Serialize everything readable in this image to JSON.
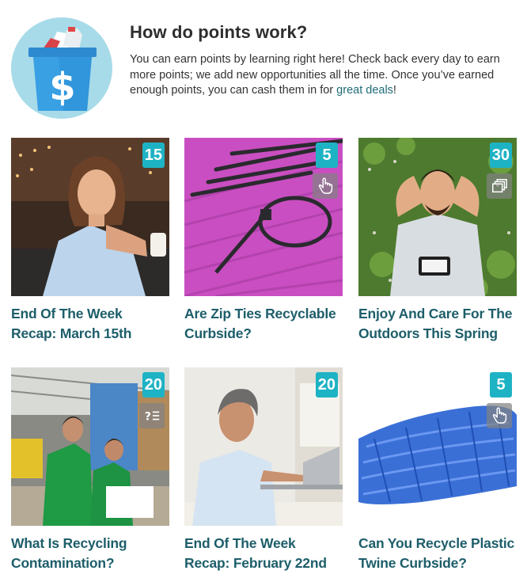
{
  "header": {
    "title": "How do points work?",
    "text_before_link": "You can earn points by learning right here! Check back every day to earn more points; we add new opportunities all the time. Once you’ve earned enough points, you can cash them in for ",
    "link_text": "great deals",
    "text_after_link": "!"
  },
  "cards": [
    {
      "points": "15",
      "type_icon": "none",
      "title": "End Of The Week Recap: March 15th"
    },
    {
      "points": "5",
      "type_icon": "hand-pointer-icon",
      "title": "Are Zip Ties Recyclable Curbside?"
    },
    {
      "points": "30",
      "type_icon": "gallery-icon",
      "title": "Enjoy And Care For The Outdoors This Spring"
    },
    {
      "points": "20",
      "type_icon": "quiz-icon",
      "title": "What Is Recycling Contamination?"
    },
    {
      "points": "20",
      "type_icon": "none",
      "title": "End Of The Week Recap: February 22nd"
    },
    {
      "points": "5",
      "type_icon": "hand-pointer-icon",
      "title": "Can You Recycle Plastic Twine Curbside?"
    }
  ],
  "colors": {
    "badge": "#1eb3c4",
    "title": "#1d5e6a",
    "link": "#1d6b77"
  }
}
